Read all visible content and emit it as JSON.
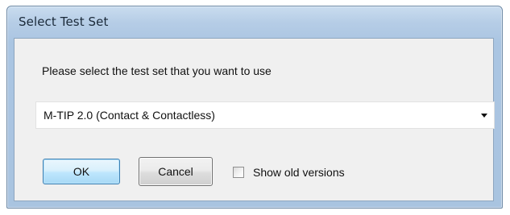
{
  "window": {
    "title": "Select Test Set"
  },
  "dialog": {
    "prompt": "Please select the test set that you want to use",
    "test_set_select": {
      "value": "M-TIP 2.0 (Contact & Contactless)"
    },
    "ok_label": "OK",
    "cancel_label": "Cancel",
    "show_old_versions": {
      "label": "Show old versions",
      "checked": false
    }
  },
  "colors": {
    "frame_blue": "#aac5e2",
    "client_bg": "#f0f0f0",
    "ok_border": "#3c7fb1"
  }
}
